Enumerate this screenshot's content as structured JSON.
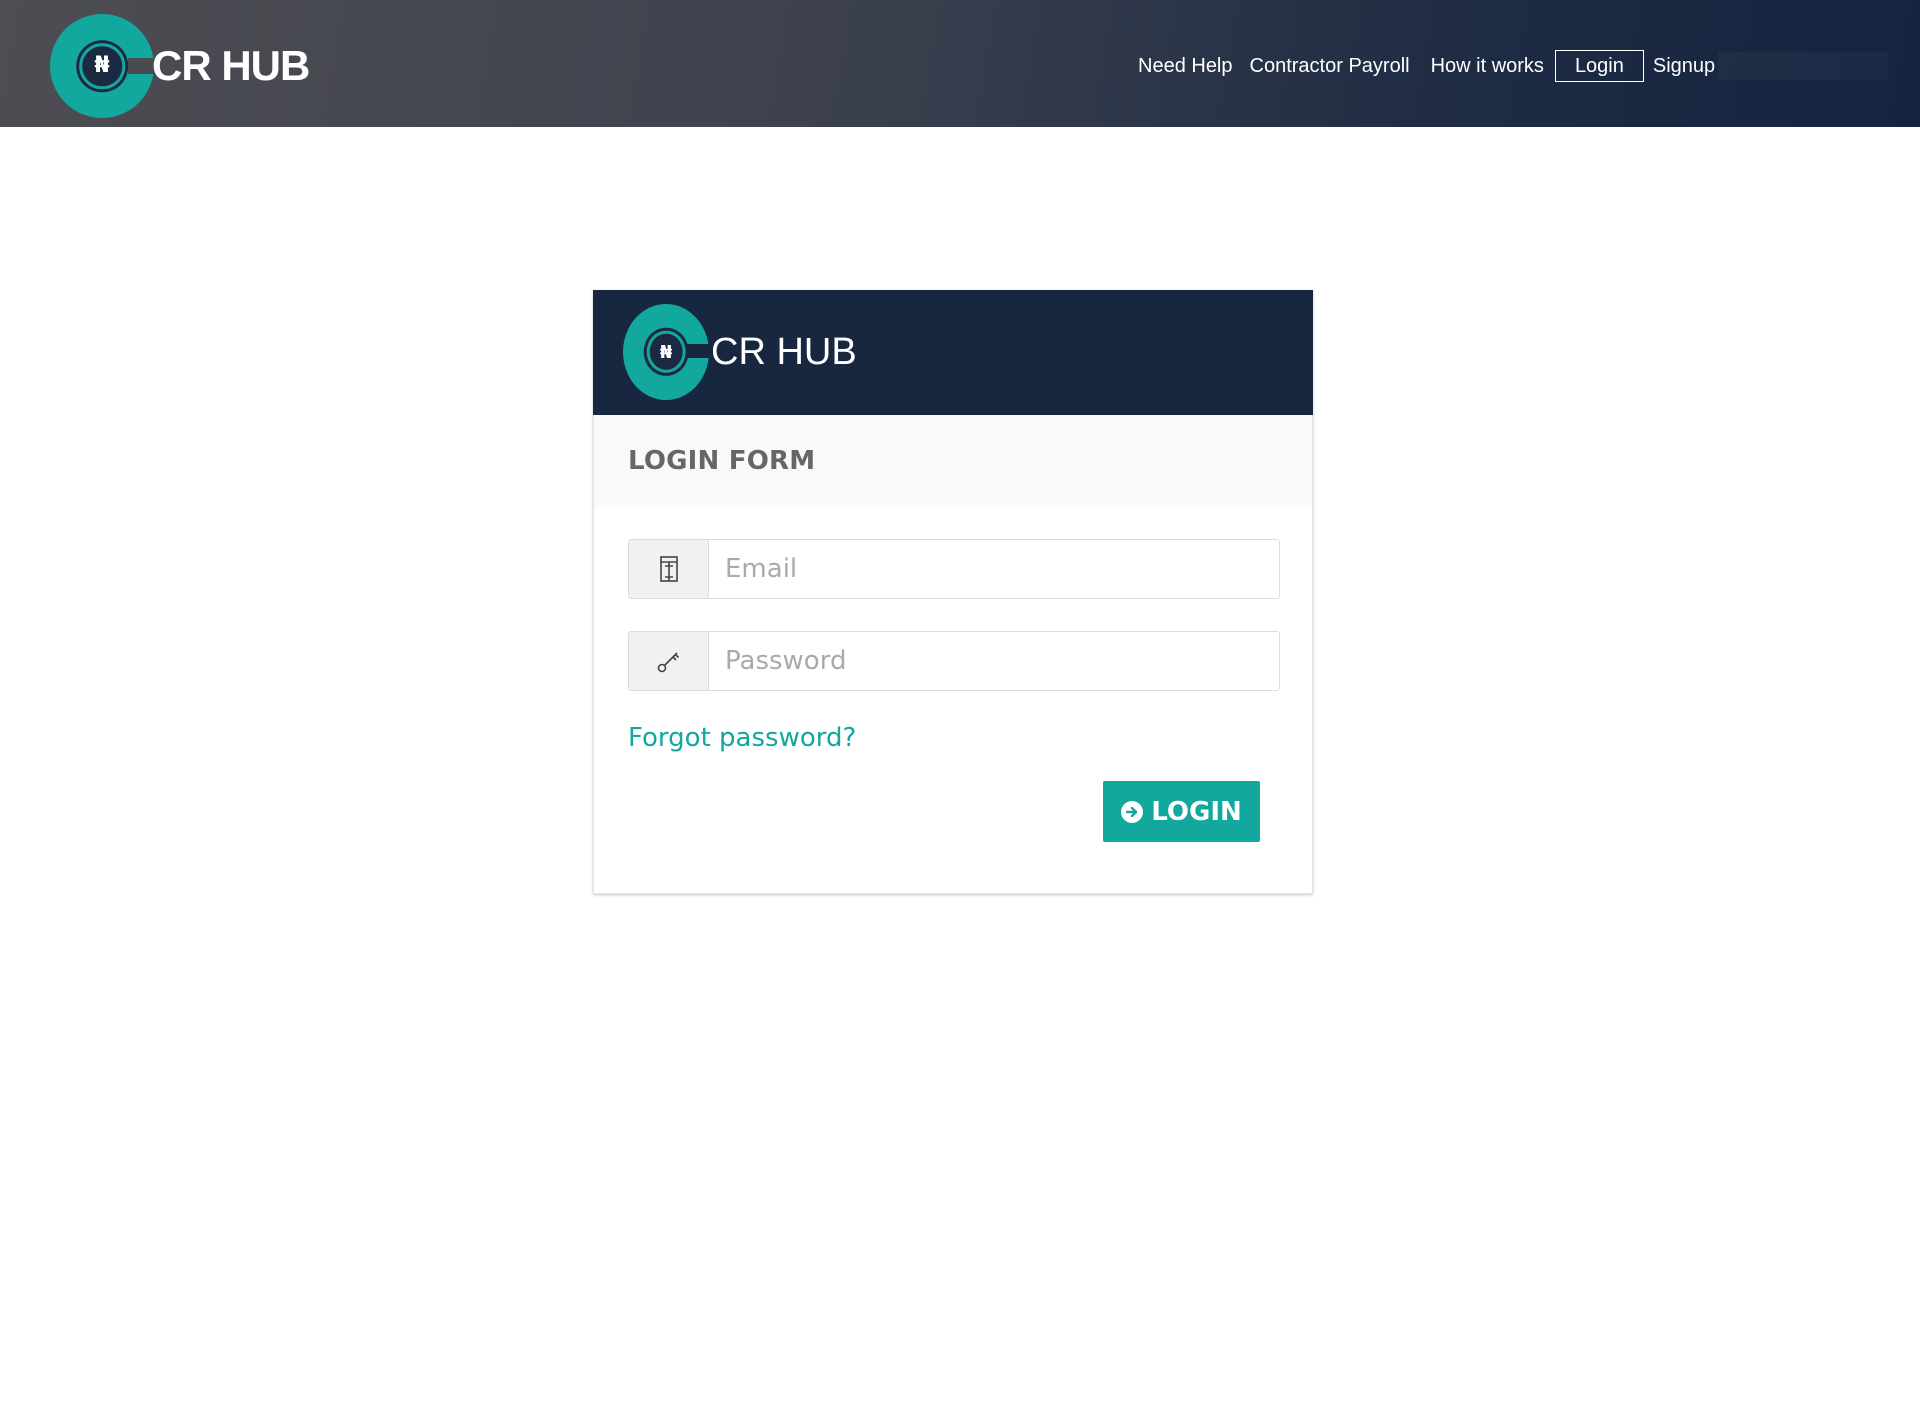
{
  "header": {
    "logo_text": "CR HUB",
    "logo_symbol": "₦",
    "nav": {
      "need_help": "Need Help",
      "contractor_payroll": "Contractor Payroll",
      "how_it_works": "How it works",
      "login": "Login",
      "signup": "Signup"
    }
  },
  "card": {
    "logo_text": "CR HUB",
    "logo_symbol": "₦",
    "form_title": "LOGIN FORM",
    "email": {
      "placeholder": "Email",
      "icon": "building-icon"
    },
    "password": {
      "placeholder": "Password",
      "icon": "key-icon"
    },
    "forgot_password": "Forgot password?",
    "login_button": {
      "label": "LOGIN",
      "icon": "circle-arrow-right-icon"
    }
  },
  "colors": {
    "accent": "#13a89e",
    "header_dark": "#172740",
    "title_gray": "#666666"
  }
}
